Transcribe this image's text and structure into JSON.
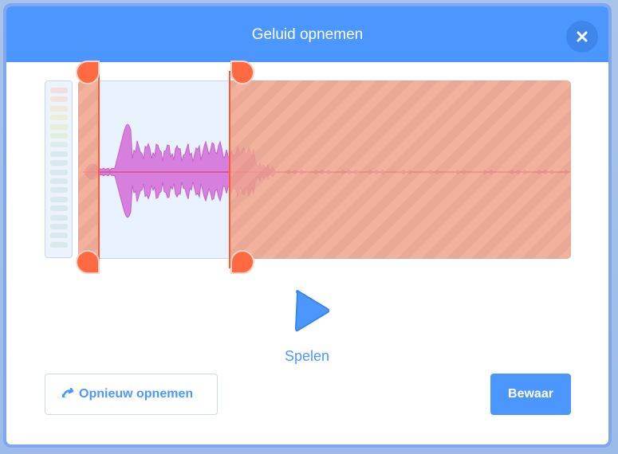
{
  "dialog": {
    "title": "Geluid opnemen",
    "close_icon": "close-icon"
  },
  "player": {
    "play_label": "Spelen",
    "play_icon": "play-icon"
  },
  "trim": {
    "start_fraction": 0.04,
    "end_fraction": 0.3
  },
  "buttons": {
    "rerecord_label": "Opnieuw opnemen",
    "rerecord_icon": "undo-icon",
    "save_label": "Bewaar"
  },
  "colors": {
    "header": "#4c97ff",
    "accent": "#4c97ff",
    "waveform": "#cf63cf",
    "trim_handle": "#ff6a43",
    "trimmed_overlay": "#f2a68c"
  }
}
